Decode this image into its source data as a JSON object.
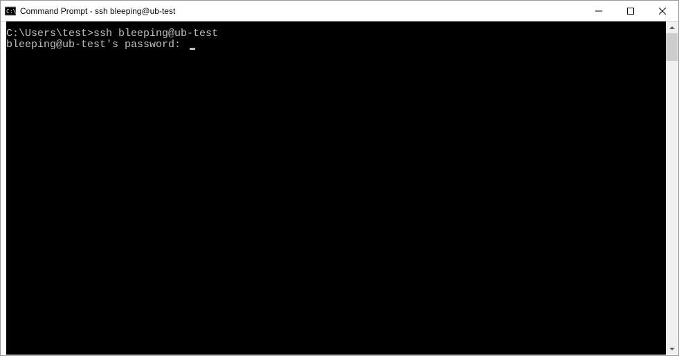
{
  "window": {
    "title": "Command Prompt - ssh  bleeping@ub-test"
  },
  "console": {
    "line1_prompt": "C:\\Users\\test>",
    "line1_command": "ssh bleeping@ub-test",
    "line2": "bleeping@ub-test's password: "
  }
}
